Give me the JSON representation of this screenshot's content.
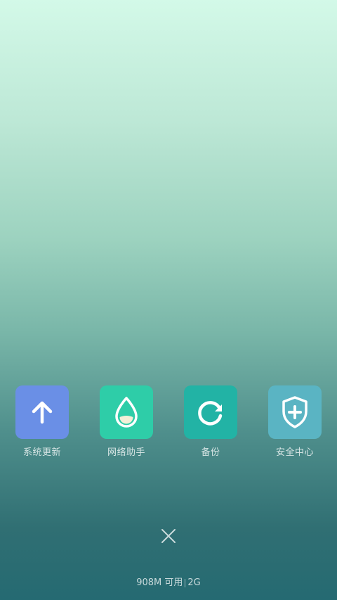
{
  "apps": [
    {
      "label": "系统更新",
      "icon": "arrow-up-icon",
      "color": "#6a8fe6"
    },
    {
      "label": "网络助手",
      "icon": "water-drop-icon",
      "color": "#2ecda8"
    },
    {
      "label": "备份",
      "icon": "refresh-icon",
      "color": "#22b3a5"
    },
    {
      "label": "安全中心",
      "icon": "shield-plus-icon",
      "color": "#5ab4c3"
    }
  ],
  "close": {
    "icon": "close-icon"
  },
  "status": {
    "memory": "908M 可用",
    "total": "2G"
  },
  "colors": {
    "background_top": "#d3f9e8",
    "background_bottom": "#256a72"
  }
}
